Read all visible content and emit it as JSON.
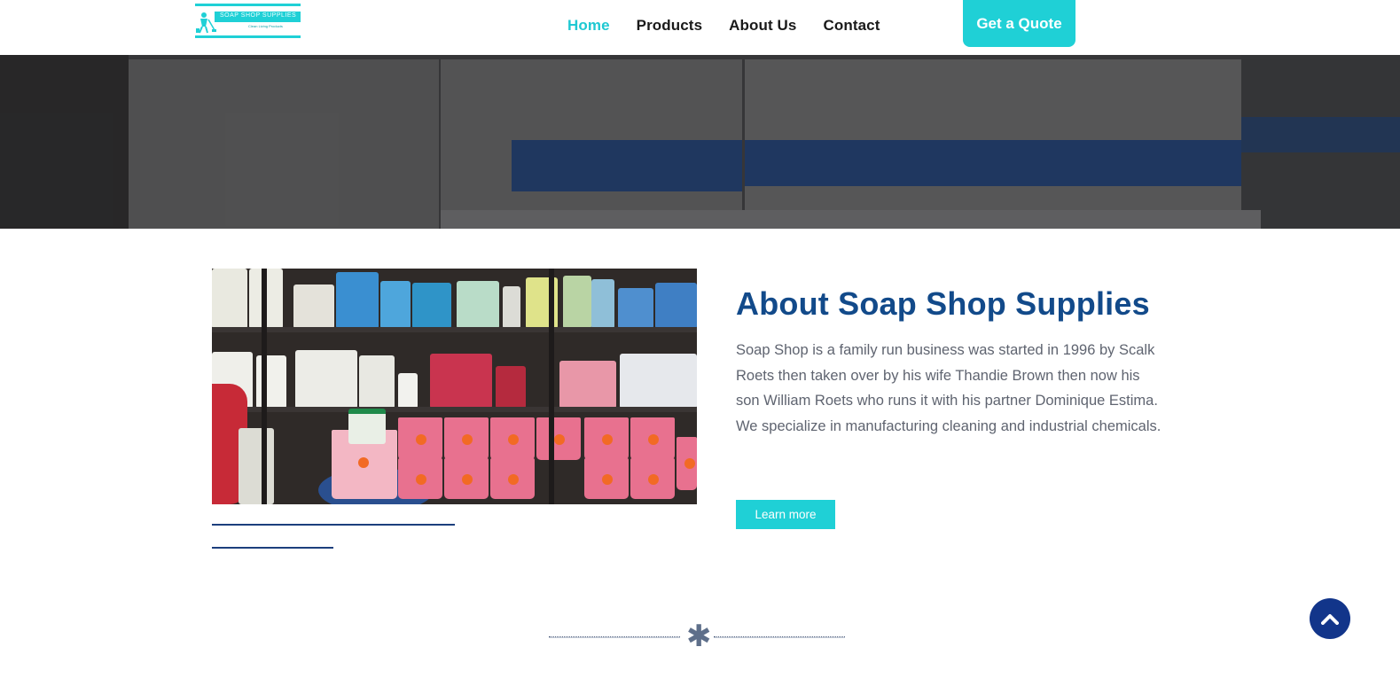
{
  "header": {
    "logo_text": "SOAP SHOP SUPPLIES",
    "logo_tagline": "Clean Living Products",
    "nav": [
      {
        "label": "Home",
        "active": true
      },
      {
        "label": "Products",
        "active": false
      },
      {
        "label": "About Us",
        "active": false
      },
      {
        "label": "Contact",
        "active": false
      }
    ],
    "quote_label": "Get a Quote"
  },
  "about": {
    "title": "About Soap Shop Supplies",
    "text": "Soap Shop is a family run business was started in 1996 by Scalk Roets then taken over by his wife Thandie Brown then now his son William Roets who runs it with his partner Dominique Estima. We specialize in manufacturing cleaning and industrial chemicals.",
    "button_label": "Learn more"
  },
  "divider": {
    "icon": "asterisk-icon"
  },
  "back_to_top": {
    "icon": "chevron-up-icon"
  },
  "colors": {
    "accent": "#1fd0d6",
    "title_blue": "#124a8a",
    "navy": "#12358a"
  }
}
